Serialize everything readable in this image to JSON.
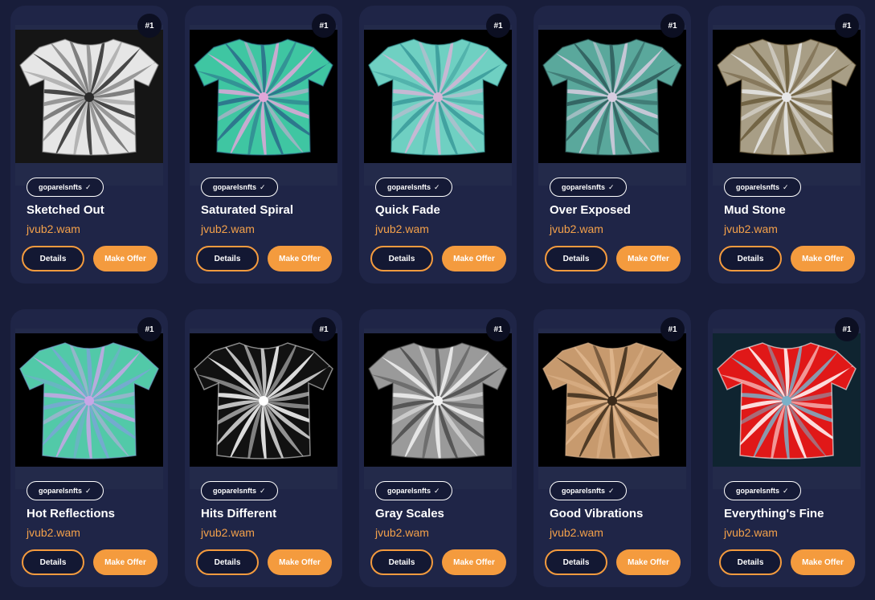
{
  "listings": [
    {
      "rank": "#1",
      "collection": "goparelsnfts",
      "title": "Sketched Out",
      "owner": "jvub2.wam",
      "details_label": "Details",
      "offer_label": "Make Offer",
      "bg": "#151515",
      "shirt": "#e6e6e6",
      "accent": "#2a2a2a",
      "accent2": "#8a8a8a"
    },
    {
      "rank": "#1",
      "collection": "goparelsnfts",
      "title": "Saturated Spiral",
      "owner": "jvub2.wam",
      "details_label": "Details",
      "offer_label": "Make Offer",
      "bg": "#000000",
      "shirt": "#3fc6a2",
      "accent": "#e0a6d8",
      "accent2": "#2a6a8a"
    },
    {
      "rank": "#1",
      "collection": "goparelsnfts",
      "title": "Quick Fade",
      "owner": "jvub2.wam",
      "details_label": "Details",
      "offer_label": "Make Offer",
      "bg": "#000000",
      "shirt": "#6fd0c2",
      "accent": "#d6b4d6",
      "accent2": "#3a9a9a"
    },
    {
      "rank": "#1",
      "collection": "goparelsnfts",
      "title": "Over Exposed",
      "owner": "jvub2.wam",
      "details_label": "Details",
      "offer_label": "Make Offer",
      "bg": "#000000",
      "shirt": "#5aa89c",
      "accent": "#d8cde0",
      "accent2": "#2e5a5a"
    },
    {
      "rank": "#1",
      "collection": "goparelsnfts",
      "title": "Mud Stone",
      "owner": "jvub2.wam",
      "details_label": "Details",
      "offer_label": "Make Offer",
      "bg": "#000000",
      "shirt": "#a89e86",
      "accent": "#e8e8e8",
      "accent2": "#6a5a3a"
    },
    {
      "rank": "#1",
      "collection": "goparelsnfts",
      "title": "Hot Reflections",
      "owner": "jvub2.wam",
      "details_label": "Details",
      "offer_label": "Make Offer",
      "bg": "#000000",
      "shirt": "#52c9a8",
      "accent": "#c8a6e6",
      "accent2": "#7aa6d6"
    },
    {
      "rank": "#1",
      "collection": "goparelsnfts",
      "title": "Hits Different",
      "owner": "jvub2.wam",
      "details_label": "Details",
      "offer_label": "Make Offer",
      "bg": "#000000",
      "shirt": "#111111",
      "accent": "#ffffff",
      "accent2": "#dddddd"
    },
    {
      "rank": "#1",
      "collection": "goparelsnfts",
      "title": "Gray Scales",
      "owner": "jvub2.wam",
      "details_label": "Details",
      "offer_label": "Make Offer",
      "bg": "#000000",
      "shirt": "#9a9a9a",
      "accent": "#f2f2f2",
      "accent2": "#4a4a4a"
    },
    {
      "rank": "#1",
      "collection": "goparelsnfts",
      "title": "Good Vibrations",
      "owner": "jvub2.wam",
      "details_label": "Details",
      "offer_label": "Make Offer",
      "bg": "#000000",
      "shirt": "#c79a6e",
      "accent": "#3a2a1a",
      "accent2": "#e0b890"
    },
    {
      "rank": "#1",
      "collection": "goparelsnfts",
      "title": "Everything's Fine",
      "owner": "jvub2.wam",
      "details_label": "Details",
      "offer_label": "Make Offer",
      "bg": "#0f2430",
      "shirt": "#e01818",
      "accent": "#7ab0c8",
      "accent2": "#ffffff"
    }
  ]
}
